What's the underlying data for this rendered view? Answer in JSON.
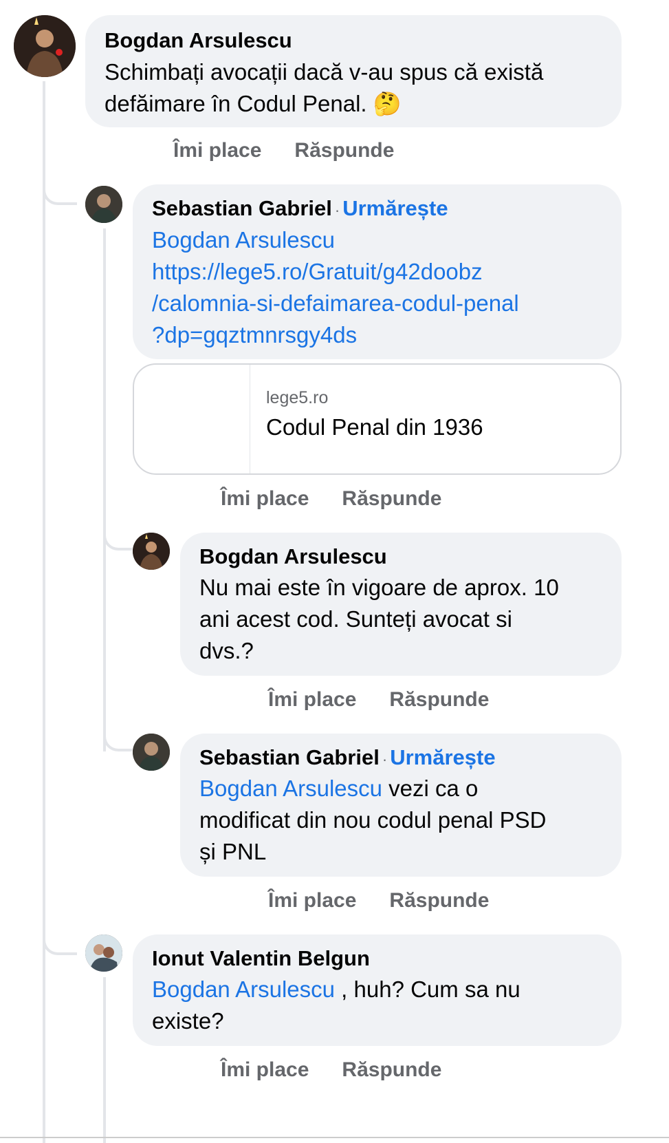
{
  "comments": [
    {
      "author": "Bogdan Arsulescu",
      "text_line1": "Schimbați avocații dacă v-au spus că există",
      "text_line2": "defăimare în Codul Penal.",
      "emoji": "🤔",
      "like_label": "Îmi place",
      "reply_label": "Răspunde"
    },
    {
      "author": "Sebastian Gabriel",
      "follow_label": "Urmărește",
      "mention": "Bogdan Arsulescu",
      "url_line1": "https://lege5.ro/Gratuit/g42doobz",
      "url_line2": "/calomnia-si-defaimarea-codul-penal",
      "url_line3": "?dp=gqztmnrsgy4ds",
      "preview_domain": "lege5.ro",
      "preview_title": "Codul Penal din 1936",
      "like_label": "Îmi place",
      "reply_label": "Răspunde"
    },
    {
      "author": "Bogdan Arsulescu",
      "text_line1": "Nu mai este în vigoare de aprox. 10",
      "text_line2": "ani acest cod. Sunteți avocat si",
      "text_line3": "dvs.?",
      "like_label": "Îmi place",
      "reply_label": "Răspunde"
    },
    {
      "author": "Sebastian Gabriel",
      "follow_label": "Urmărește",
      "mention": "Bogdan Arsulescu",
      "text_line1": " vezi ca o",
      "text_line2": "modificat din nou codul penal PSD",
      "text_line3": "și PNL",
      "like_label": "Îmi place",
      "reply_label": "Răspunde"
    },
    {
      "author": "Ionut Valentin Belgun",
      "mention": "Bogdan Arsulescu",
      "text_line1": " , huh? Cum sa nu",
      "text_line2": "existe?",
      "like_label": "Îmi place",
      "reply_label": "Răspunde"
    }
  ],
  "dot_separator": "·"
}
